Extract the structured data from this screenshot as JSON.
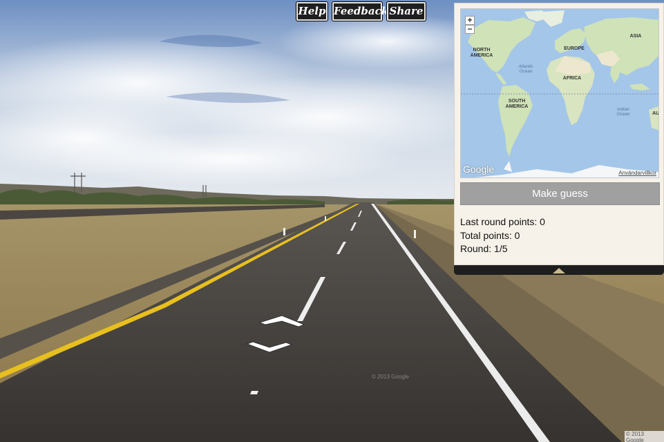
{
  "toolbar": {
    "help_label": "Help",
    "feedback_label": "Feedback",
    "share_label": "Share"
  },
  "map": {
    "zoom_in": "+",
    "zoom_out": "−",
    "continents": {
      "north_america": "NORTH AMERICA",
      "south_america": "SOUTH AMERICA",
      "europe": "EUROPE",
      "africa": "AFRICA",
      "asia": "ASIA",
      "australia": "AU"
    },
    "oceans": {
      "atlantic": "Atlantic Ocean",
      "indian": "Indian Ocean"
    },
    "logo": "Google",
    "terms": "Användarvillkor"
  },
  "guess_button": "Make guess",
  "stats": {
    "last_round": "Last round points: 0",
    "total": "Total points: 0",
    "round": "Round: 1/5"
  },
  "watermarks": {
    "center": "© 2013 Google",
    "corner": "© 2013 Google"
  },
  "colors": {
    "road": "#3d3a37",
    "yellow_line": "#e8c01e",
    "panel_bg": "#f6f1e9",
    "guess_button": "#a0a0a0",
    "water": "#a4c6e8",
    "land": "#cfe2b8"
  }
}
